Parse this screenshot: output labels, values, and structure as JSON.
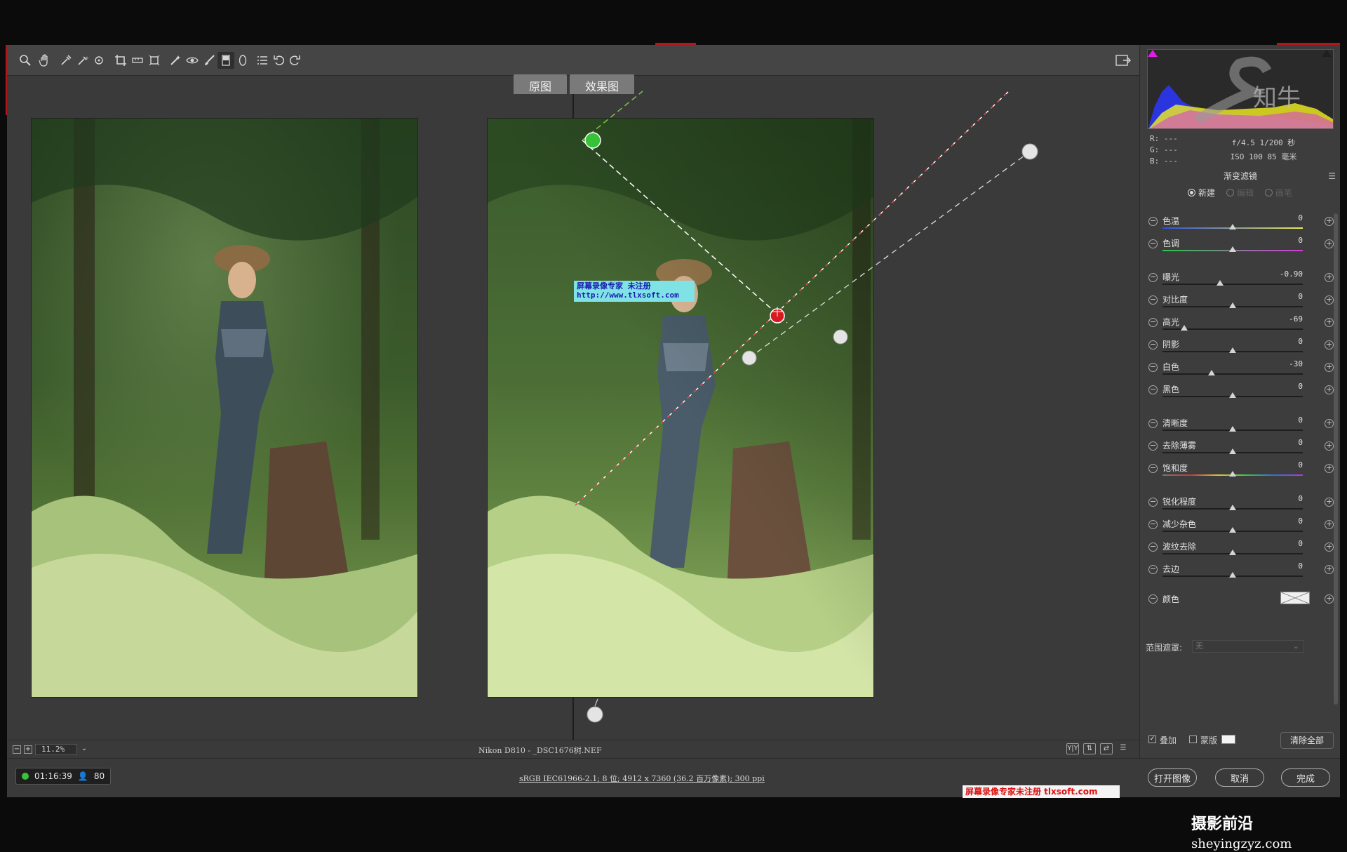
{
  "toolbar": {
    "tools": [
      "zoom-tool",
      "hand-tool",
      "white-balance-tool",
      "color-sampler-tool",
      "targeted-adjustment-tool",
      "crop-tool",
      "straighten-tool",
      "transform-tool",
      "spot-removal-tool",
      "red-eye-tool",
      "adjustment-brush-tool",
      "graduated-filter-tool",
      "radial-filter-tool",
      "preferences-tool",
      "rotate-left-tool",
      "rotate-right-tool"
    ]
  },
  "view_tabs": {
    "before": "原图",
    "after": "效果图"
  },
  "watermark": {
    "line1": "屏幕录像专家    未注册",
    "line2": "http://www.tlxsoft.com"
  },
  "status": {
    "zoom": "11.2%",
    "filename": "Nikon D810 -  _DSC1676树.NEF"
  },
  "bottom": {
    "timer": "01:16:39",
    "count": "80",
    "info": "sRGB IEC61966-2.1; 8 位; 4912 x 7360 (36.2 百万像素); 300 ppi",
    "open_image": "打开图像",
    "cancel": "取消",
    "done": "完成",
    "red_watermark": "屏幕录像专家未注册 tlxsoft.com"
  },
  "panel": {
    "rgb": {
      "r": "R:  ---",
      "g": "G:  ---",
      "b": "B:  ---"
    },
    "exposure_info_1": "f/4.5   1/200 秒",
    "exposure_info_2": "ISO 100   85 毫米",
    "title": "渐变滤镜",
    "modes": [
      "新建",
      "编辑",
      "画笔"
    ],
    "sliders": [
      {
        "label": "色温",
        "value": "0",
        "pos": 0.5
      },
      {
        "label": "色调",
        "value": "0",
        "pos": 0.5
      },
      {
        "label": "曝光",
        "value": "-0.90",
        "pos": 0.41
      },
      {
        "label": "对比度",
        "value": "0",
        "pos": 0.5
      },
      {
        "label": "高光",
        "value": "-69",
        "pos": 0.155
      },
      {
        "label": "阴影",
        "value": "0",
        "pos": 0.5
      },
      {
        "label": "白色",
        "value": "-30",
        "pos": 0.35
      },
      {
        "label": "黑色",
        "value": "0",
        "pos": 0.5
      },
      {
        "label": "清晰度",
        "value": "0",
        "pos": 0.5
      },
      {
        "label": "去除薄雾",
        "value": "0",
        "pos": 0.5
      },
      {
        "label": "饱和度",
        "value": "0",
        "pos": 0.5
      },
      {
        "label": "锐化程度",
        "value": "0",
        "pos": 0.5
      },
      {
        "label": "减少杂色",
        "value": "0",
        "pos": 0.5
      },
      {
        "label": "波纹去除",
        "value": "0",
        "pos": 0.5
      },
      {
        "label": "去边",
        "value": "0",
        "pos": 0.5
      }
    ],
    "color_label": "颜色",
    "range_mask_label": "范围遮罩:",
    "range_mask_value": "无",
    "overlay_label": "叠加",
    "mask_label": "蒙版",
    "clear_all": "清除全部"
  },
  "brand": {
    "cn": "摄影前沿",
    "url": "sheyingzyz.com"
  },
  "colors": {
    "accent_green": "#38c23a",
    "pin_red": "#d8191f",
    "red_marks": "#b5141a"
  }
}
